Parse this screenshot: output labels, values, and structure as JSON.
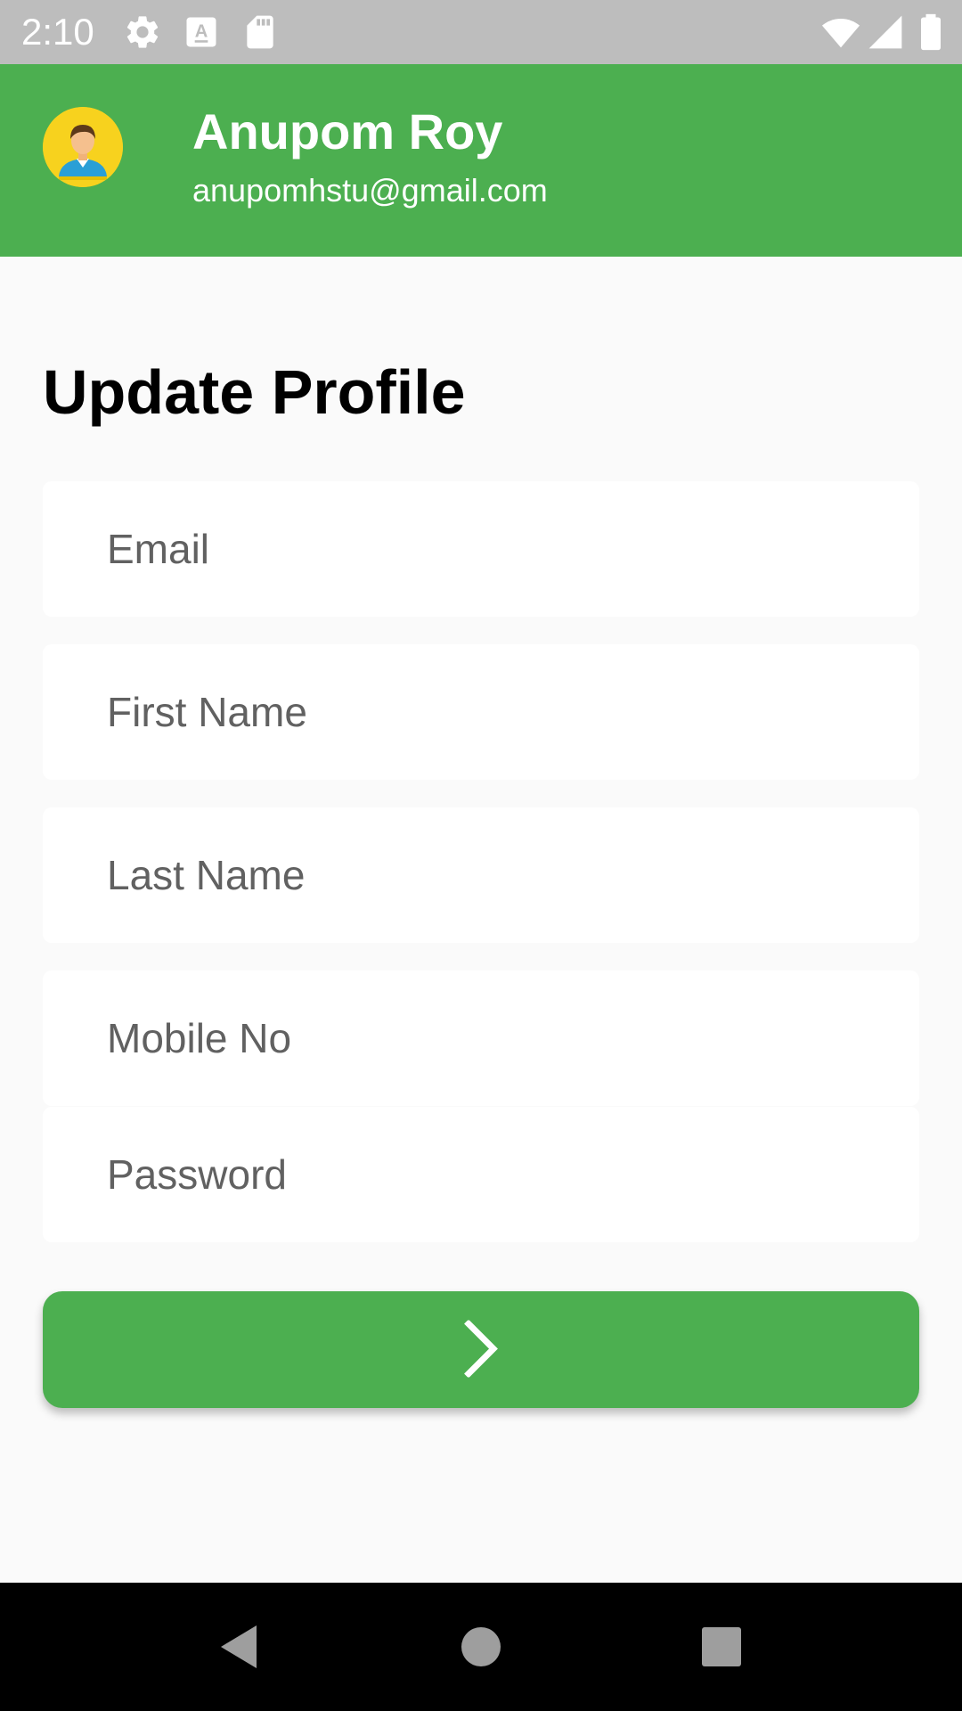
{
  "status_bar": {
    "time": "2:10",
    "icons": [
      "gear-icon",
      "font-icon",
      "sd-card-icon",
      "wifi-icon",
      "signal-icon",
      "battery-icon"
    ]
  },
  "header": {
    "name": "Anupom Roy",
    "email": "anupomhstu@gmail.com",
    "avatar_bg": "#f7d21e",
    "bg_color": "#4caf50"
  },
  "form": {
    "title": "Update Profile",
    "fields": [
      {
        "placeholder": "Email",
        "value": ""
      },
      {
        "placeholder": "First Name",
        "value": ""
      },
      {
        "placeholder": "Last Name",
        "value": ""
      },
      {
        "placeholder": "Mobile No",
        "value": ""
      },
      {
        "placeholder": "Password",
        "value": ""
      }
    ],
    "submit_icon": "chevron-right-icon",
    "accent_color": "#4caf50"
  },
  "nav_bar": {
    "buttons": [
      "back-icon",
      "home-icon",
      "recents-icon"
    ]
  }
}
